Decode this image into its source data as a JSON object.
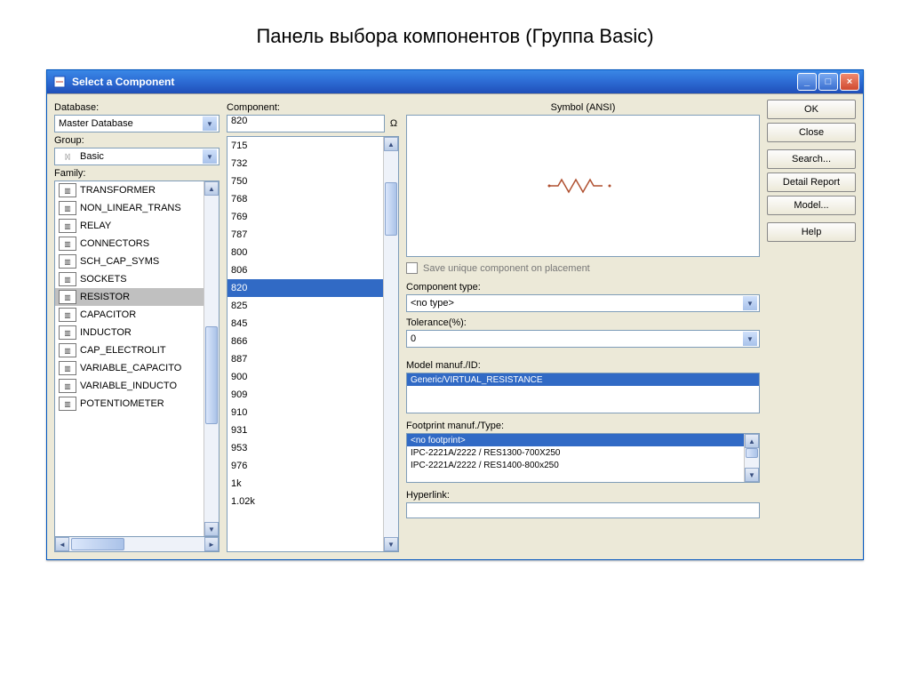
{
  "page_title": "Панель выбора компонентов (Группа Basic)",
  "window_title": "Select a Component",
  "labels": {
    "database": "Database:",
    "component": "Component:",
    "group": "Group:",
    "family": "Family:",
    "symbol": "Symbol (ANSI)",
    "component_type": "Component type:",
    "tolerance": "Tolerance(%):",
    "model": "Model manuf./ID:",
    "footprint": "Footprint manuf./Type:",
    "hyperlink": "Hyperlink:",
    "save_unique": "Save unique component on placement"
  },
  "database_value": "Master Database",
  "group_value": "Basic",
  "component_value": "820",
  "component_unit": "Ω",
  "component_type_value": "<no type>",
  "tolerance_value": "0",
  "buttons": {
    "ok": "OK",
    "close": "Close",
    "search": "Search...",
    "detail": "Detail Report",
    "model": "Model...",
    "help": "Help"
  },
  "family_items": [
    "TRANSFORMER",
    "NON_LINEAR_TRANS",
    "RELAY",
    "CONNECTORS",
    "SCH_CAP_SYMS",
    "SOCKETS",
    "RESISTOR",
    "CAPACITOR",
    "INDUCTOR",
    "CAP_ELECTROLIT",
    "VARIABLE_CAPACITO",
    "VARIABLE_INDUCTO",
    "POTENTIOMETER"
  ],
  "family_selected_index": 6,
  "component_items": [
    "715",
    "732",
    "750",
    "768",
    "769",
    "787",
    "800",
    "806",
    "820",
    "825",
    "845",
    "866",
    "887",
    "900",
    "909",
    "910",
    "931",
    "953",
    "976",
    "1k",
    "1.02k"
  ],
  "component_selected_index": 8,
  "model_items": [
    "Generic/VIRTUAL_RESISTANCE"
  ],
  "footprint_items": [
    "<no footprint>",
    "IPC-2221A/2222 / RES1300-700X250",
    "IPC-2221A/2222 / RES1400-800x250"
  ]
}
